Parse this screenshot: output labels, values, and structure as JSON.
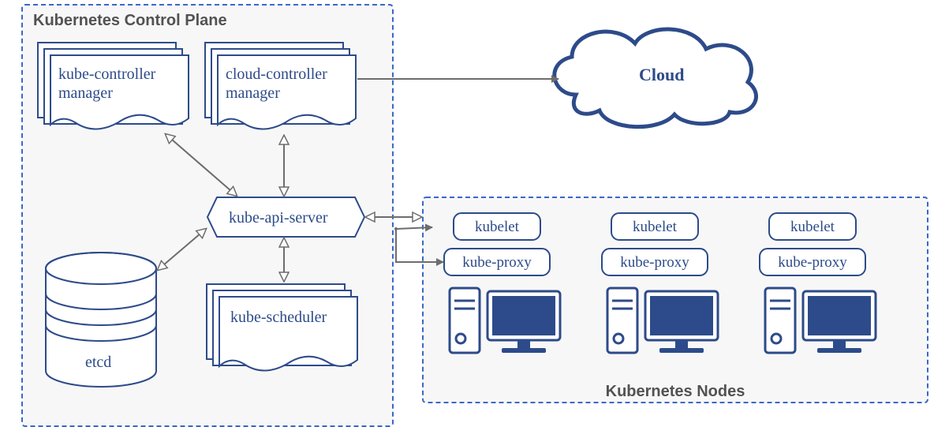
{
  "diagram": {
    "controlPlane": {
      "title": "Kubernetes Control Plane",
      "kubeControllerManager": "kube-controller\nmanager",
      "cloudControllerManager": "cloud-controller\nmanager",
      "kubeApiServer": "kube-api-server",
      "kubeScheduler": "kube-scheduler",
      "etcd": "etcd"
    },
    "nodesGroup": {
      "title": "Kubernetes Nodes",
      "nodes": [
        {
          "kubelet": "kubelet",
          "kubeProxy": "kube-proxy"
        },
        {
          "kubelet": "kubelet",
          "kubeProxy": "kube-proxy"
        },
        {
          "kubelet": "kubelet",
          "kubeProxy": "kube-proxy"
        }
      ]
    },
    "cloud": "Cloud"
  },
  "colors": {
    "stroke": "#2d4b8a",
    "dashed": "#3a68c8",
    "text": "#2d4b8a",
    "groupText": "#525252",
    "fillLight": "#f2f2f2",
    "arrow": "#6d6d6d"
  }
}
